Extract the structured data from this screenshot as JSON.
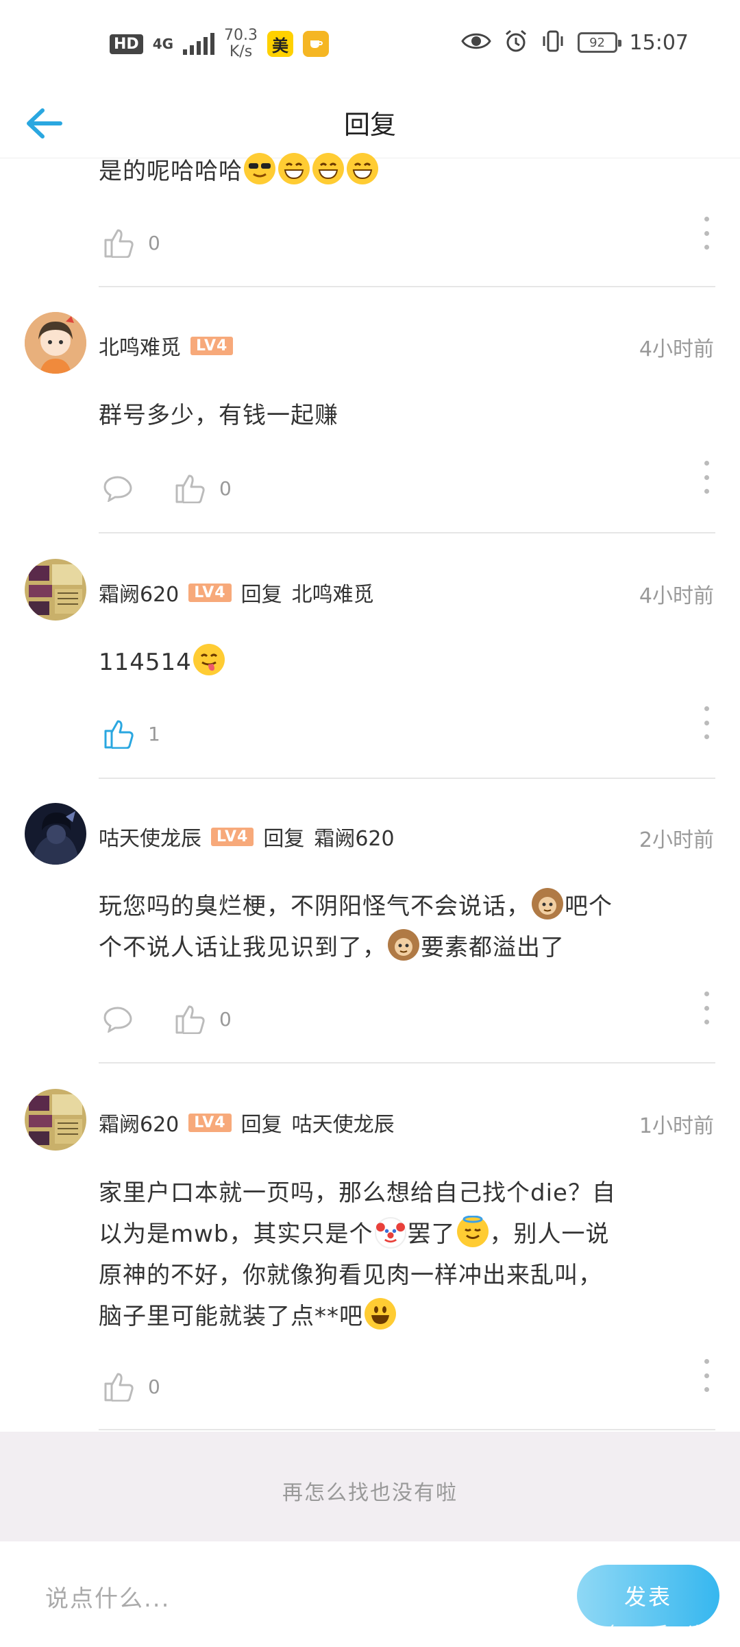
{
  "status_bar": {
    "hd": "HD",
    "network": "4G",
    "speed_value": "70.3",
    "speed_unit": "K/s",
    "app1": "美",
    "battery": "92",
    "time": "15:07"
  },
  "header": {
    "title": "回复"
  },
  "comments": [
    {
      "text": "是的呢哈哈哈",
      "likes": "0"
    },
    {
      "name": "北鸣难觅",
      "level": "LV4",
      "time": "4小时前",
      "text": "群号多少，有钱一起赚",
      "likes": "0"
    },
    {
      "name": "霜阙620",
      "level": "LV4",
      "reply_word": "回复",
      "reply_to": "北鸣难觅",
      "time": "4小时前",
      "text": "114514",
      "likes": "1"
    },
    {
      "name": "咕天使龙辰",
      "level": "LV4",
      "reply_word": "回复",
      "reply_to": "霜阙620",
      "time": "2小时前",
      "text_line1a": "玩您吗的臭烂梗，不阴阳怪气不会说话，",
      "text_line1b": "吧个",
      "text_line2a": "个不说人话让我见识到了，",
      "text_line2b": "要素都溢出了",
      "likes": "0"
    },
    {
      "name": "霜阙620",
      "level": "LV4",
      "reply_word": "回复",
      "reply_to": "咕天使龙辰",
      "time": "1小时前",
      "text_line1": "家里户口本就一页吗，那么想给自己找个die？自",
      "text_line2a": "以为是mwb，其实只是个",
      "text_line2b": "罢了",
      "text_line2c": "，别人一说",
      "text_line3": "原神的不好，你就像狗看见肉一样冲出来乱叫，",
      "text_line4": "脑子里可能就装了点**吧",
      "likes": "0"
    }
  ],
  "end_text": "再怎么找也没有啦",
  "composer": {
    "placeholder": "说点什么...",
    "send_label": "发表",
    "watermark": "头条 @后三迩三"
  },
  "colors": {
    "accent": "#2aa7e0",
    "level_badge": "#f7a97a",
    "time_gray": "#999999"
  }
}
